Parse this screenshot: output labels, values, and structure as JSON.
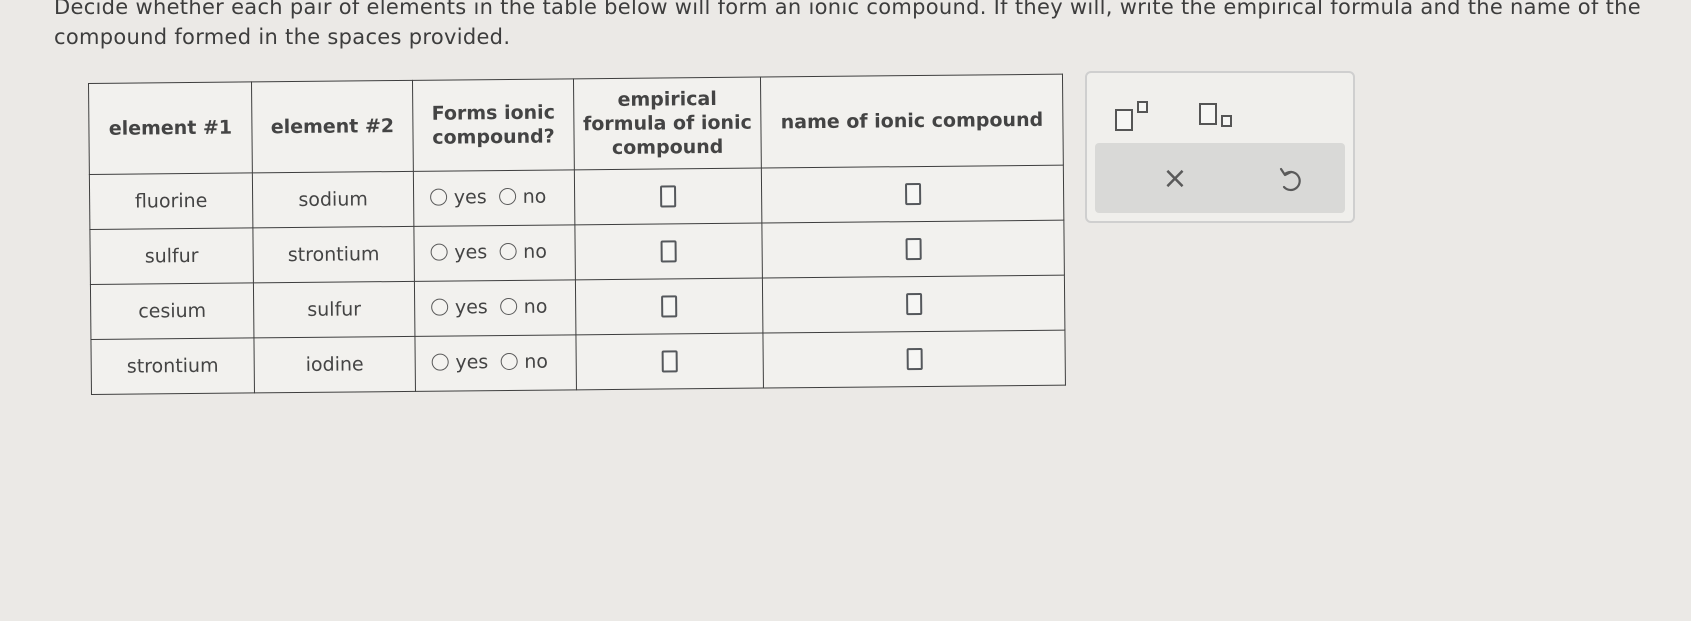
{
  "instructions": {
    "line1": "Decide whether each pair of elements in the table below will form an ionic compound. If they will, write the empirical formula and the name of the",
    "line2": "compound formed in the spaces provided."
  },
  "table": {
    "headers": {
      "element1": "element #1",
      "element2": "element #2",
      "forms_ionic": "Forms ionic compound?",
      "formula": "empirical formula of ionic compound",
      "name": "name of ionic compound"
    },
    "yes_label": "yes",
    "no_label": "no",
    "rows": [
      {
        "element1": "fluorine",
        "element2": "sodium"
      },
      {
        "element1": "sulfur",
        "element2": "strontium"
      },
      {
        "element1": "cesium",
        "element2": "sulfur"
      },
      {
        "element1": "strontium",
        "element2": "iodine"
      }
    ]
  },
  "tool_panel": {
    "superscript_icon": "superscript-icon",
    "subscript_icon": "subscript-icon",
    "clear_label": "×",
    "undo_icon": "undo-icon"
  }
}
